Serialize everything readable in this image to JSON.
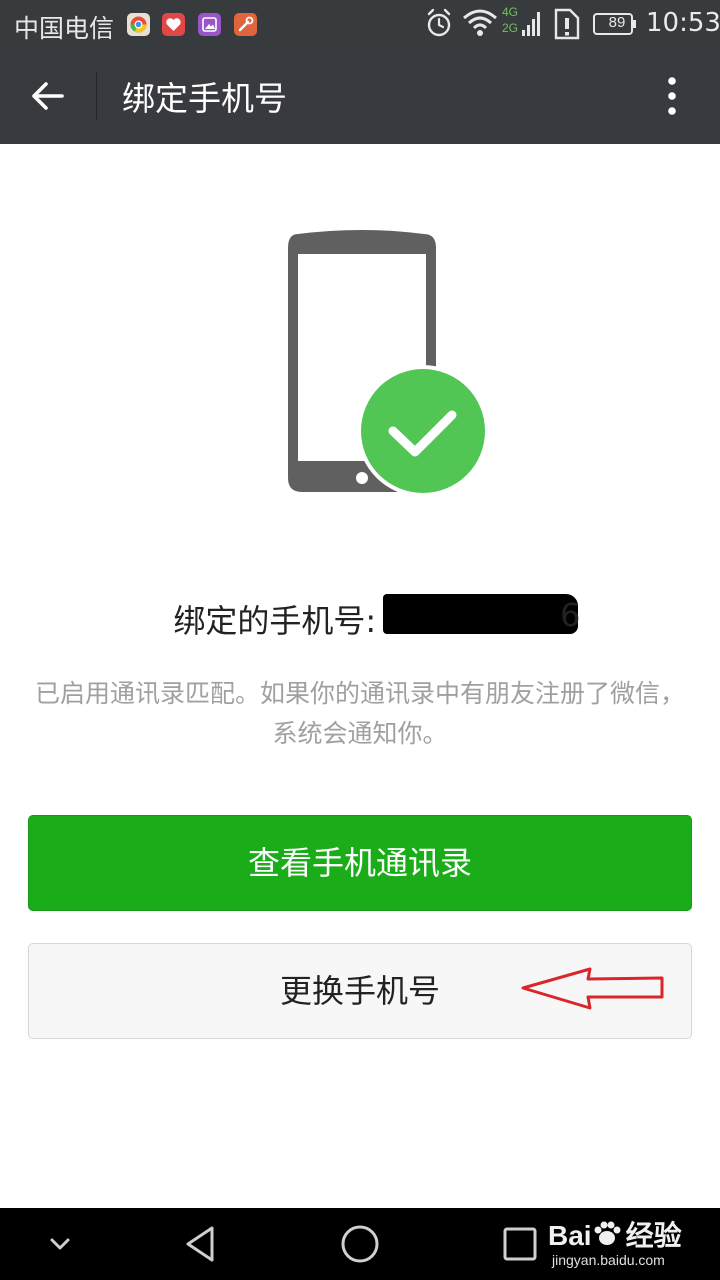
{
  "status_bar": {
    "carrier": "中国电信",
    "network_top": "4G",
    "network_bottom": "2G",
    "battery": "89",
    "time": "10:53",
    "icons": [
      "app-icon-chrome",
      "app-icon-health",
      "app-icon-gallery",
      "app-icon-tools",
      "alarm-icon",
      "wifi-icon",
      "signal-icon",
      "sim-alert-icon",
      "battery-icon"
    ]
  },
  "app_bar": {
    "title": "绑定手机号",
    "back_icon": "arrow-left-icon",
    "more_icon": "more-vertical-icon"
  },
  "hero": {
    "icon": "phone-check-icon",
    "check_color": "#52c655",
    "phone_color": "#606060"
  },
  "binding": {
    "label": "绑定的手机号: 1",
    "suffix": "6"
  },
  "description": "已启用通讯录匹配。如果你的通讯录中有朋友注册了微信，系统会通知你。",
  "buttons": {
    "view_contacts": "查看手机通讯录",
    "change_number": "更换手机号"
  },
  "colors": {
    "primary_green": "#1aad19",
    "app_bar": "#393a3f",
    "annotation_red": "#d9262c"
  },
  "watermark": {
    "brand": "Bai",
    "brand_cn": "经验",
    "url": "jingyan.baidu.com"
  }
}
